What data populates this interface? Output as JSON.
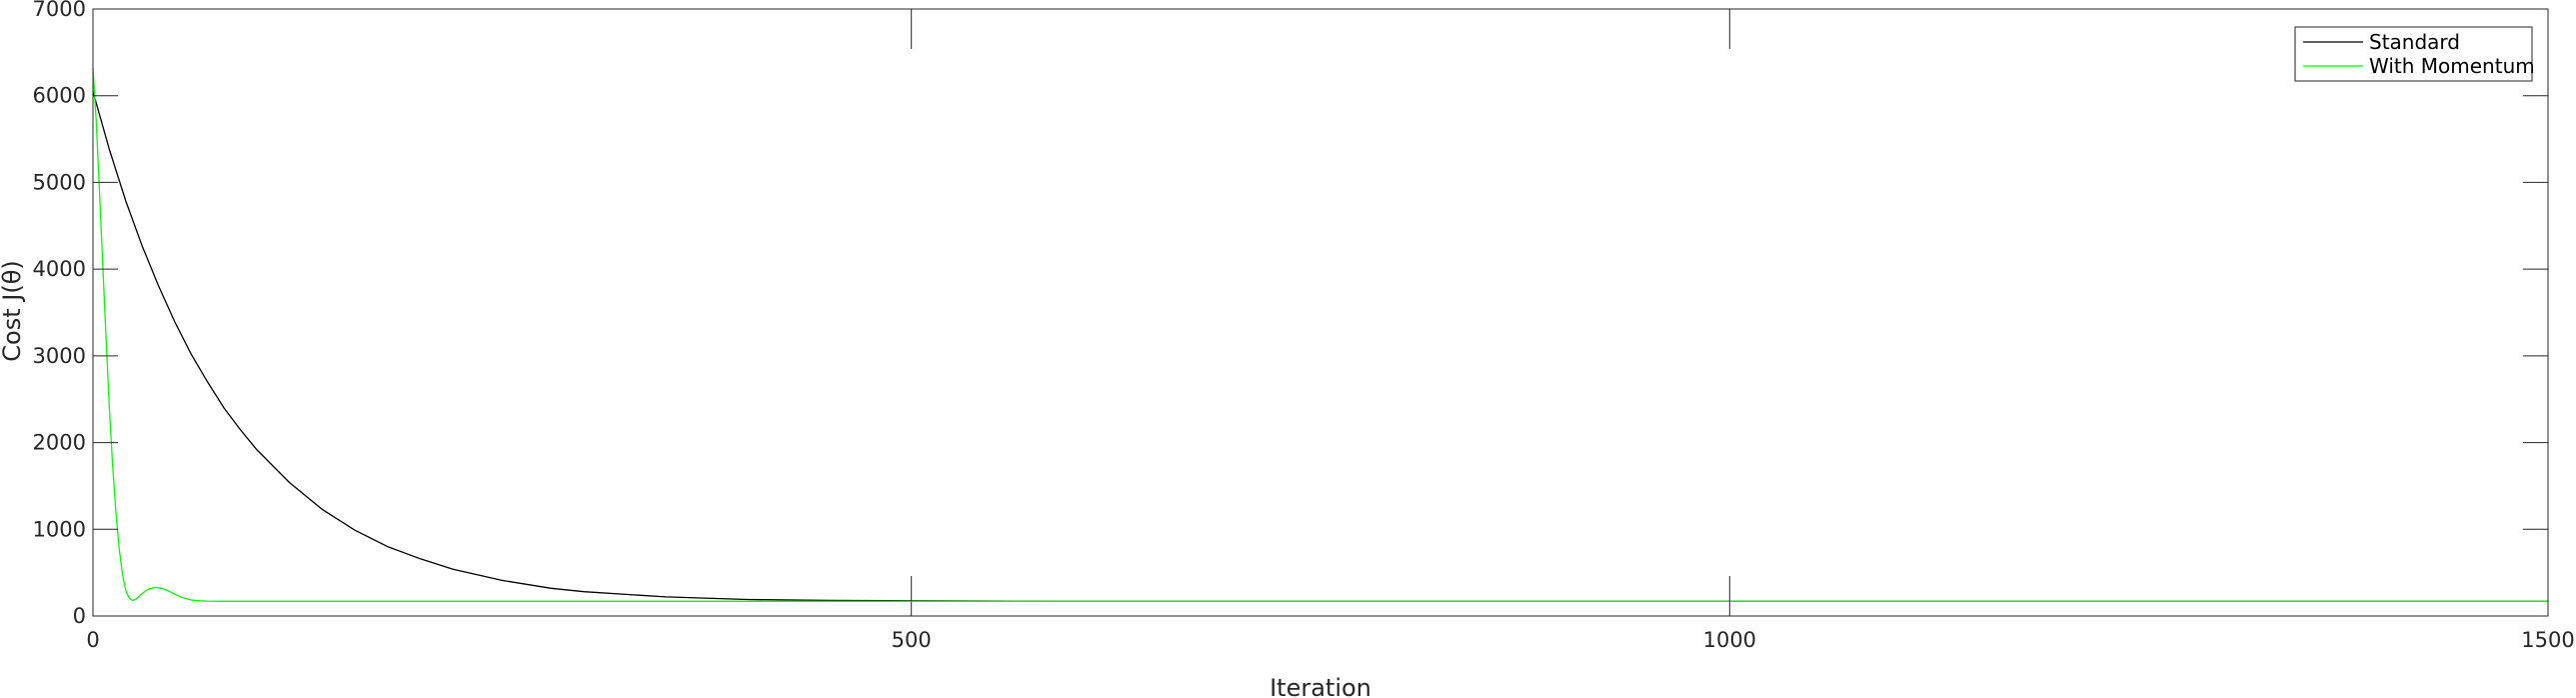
{
  "chart_data": {
    "type": "line",
    "title": "",
    "xlabel": "Iteration",
    "ylabel": "Cost J(θ)",
    "xlim": [
      0,
      1500
    ],
    "ylim": [
      0,
      7000
    ],
    "xticks": [
      0,
      500,
      1000,
      1500
    ],
    "yticks": [
      0,
      1000,
      2000,
      3000,
      4000,
      5000,
      6000,
      7000
    ],
    "grid": false,
    "legend_position": "top-right",
    "series": [
      {
        "name": "Standard",
        "color": "#000000",
        "x": [
          0,
          10,
          20,
          30,
          40,
          50,
          60,
          70,
          80,
          90,
          100,
          120,
          140,
          160,
          180,
          200,
          220,
          250,
          280,
          300,
          350,
          400,
          450,
          500,
          600,
          800,
          1000,
          1200,
          1500
        ],
        "y": [
          6050,
          5380,
          4790,
          4270,
          3810,
          3390,
          3020,
          2700,
          2400,
          2150,
          1920,
          1540,
          1230,
          990,
          800,
          660,
          540,
          410,
          320,
          280,
          220,
          190,
          180,
          175,
          170,
          170,
          170,
          170,
          170
        ]
      },
      {
        "name": "With Momentum",
        "color": "#00ff00",
        "x": [
          0,
          2,
          4,
          6,
          8,
          10,
          12,
          14,
          16,
          18,
          20,
          22,
          24,
          26,
          28,
          30,
          34,
          38,
          42,
          46,
          50,
          55,
          60,
          65,
          70,
          80,
          100,
          150,
          200,
          500,
          1000,
          1500
        ],
        "y": [
          6320,
          5700,
          4900,
          4050,
          3200,
          2400,
          1750,
          1200,
          780,
          480,
          300,
          210,
          180,
          190,
          220,
          260,
          310,
          330,
          320,
          290,
          250,
          210,
          185,
          175,
          172,
          170,
          170,
          170,
          170,
          170,
          170,
          170
        ]
      }
    ]
  }
}
